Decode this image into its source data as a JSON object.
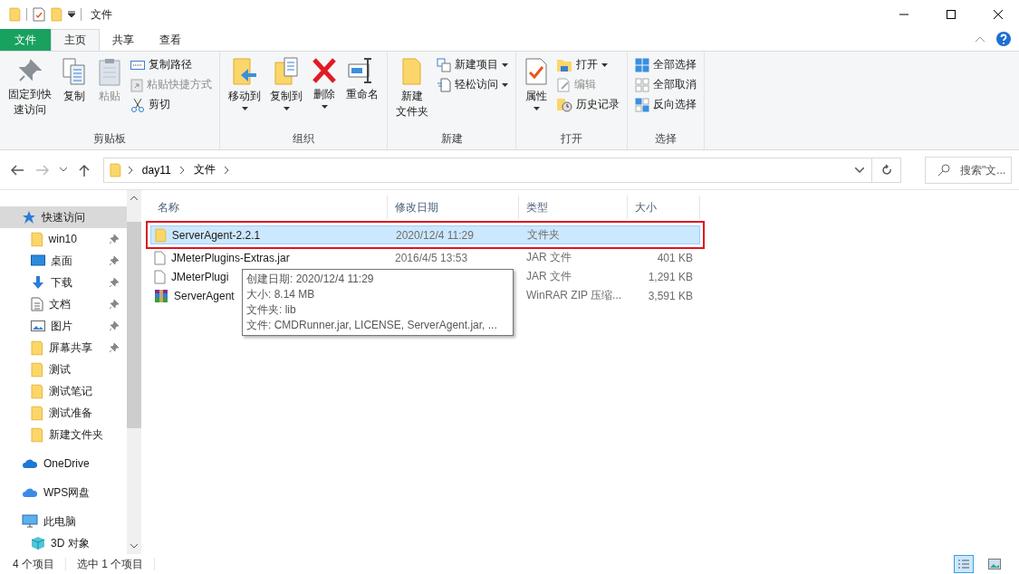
{
  "title_bar": {
    "title": "文件"
  },
  "ribbon_tabs": [
    {
      "label": "文件",
      "selected": false,
      "kind": "backstage"
    },
    {
      "label": "主页",
      "selected": true,
      "kind": "tab"
    },
    {
      "label": "共享",
      "selected": false,
      "kind": "tab"
    },
    {
      "label": "查看",
      "selected": false,
      "kind": "tab"
    }
  ],
  "ribbon_groups": [
    {
      "title": "剪贴板",
      "buttons": [
        {
          "kind": "large",
          "lines": [
            "固定到快",
            "速访问"
          ],
          "disabled": false,
          "dropdown": false
        },
        {
          "kind": "large",
          "lines": [
            "复制"
          ],
          "disabled": false,
          "dropdown": false
        },
        {
          "kind": "large",
          "lines": [
            "粘贴"
          ],
          "disabled": true,
          "dropdown": false
        },
        {
          "kind": "small",
          "lines": [
            "复制路径"
          ],
          "disabled": false,
          "dropdown": false
        },
        {
          "kind": "small",
          "lines": [
            "粘贴快捷方式"
          ],
          "disabled": true,
          "dropdown": false
        },
        {
          "kind": "small",
          "lines": [
            "剪切"
          ],
          "disabled": false,
          "dropdown": false
        }
      ]
    },
    {
      "title": "组织",
      "buttons": [
        {
          "kind": "large",
          "lines": [
            "移动到"
          ],
          "disabled": false,
          "dropdown": true
        },
        {
          "kind": "large",
          "lines": [
            "复制到"
          ],
          "disabled": false,
          "dropdown": true
        },
        {
          "kind": "large",
          "lines": [
            "删除"
          ],
          "disabled": false,
          "dropdown": true
        },
        {
          "kind": "large",
          "lines": [
            "重命名"
          ],
          "disabled": false,
          "dropdown": false
        }
      ]
    },
    {
      "title": "新建",
      "buttons": [
        {
          "kind": "large",
          "lines": [
            "新建",
            "文件夹"
          ],
          "disabled": false,
          "dropdown": false
        },
        {
          "kind": "small",
          "lines": [
            "新建项目"
          ],
          "disabled": false,
          "dropdown": true
        },
        {
          "kind": "small",
          "lines": [
            "轻松访问"
          ],
          "disabled": false,
          "dropdown": true
        }
      ]
    },
    {
      "title": "打开",
      "buttons": [
        {
          "kind": "large",
          "lines": [
            "属性"
          ],
          "disabled": false,
          "dropdown": true
        },
        {
          "kind": "small",
          "lines": [
            "打开"
          ],
          "disabled": false,
          "dropdown": true
        },
        {
          "kind": "small",
          "lines": [
            "编辑"
          ],
          "disabled": true,
          "dropdown": false
        },
        {
          "kind": "small",
          "lines": [
            "历史记录"
          ],
          "disabled": false,
          "dropdown": false
        }
      ]
    },
    {
      "title": "选择",
      "buttons": [
        {
          "kind": "small",
          "lines": [
            "全部选择"
          ],
          "disabled": false,
          "dropdown": false
        },
        {
          "kind": "small",
          "lines": [
            "全部取消"
          ],
          "disabled": false,
          "dropdown": false
        },
        {
          "kind": "small",
          "lines": [
            "反向选择"
          ],
          "disabled": false,
          "dropdown": false
        }
      ]
    }
  ],
  "address_bar": {
    "path": [
      "day11",
      "文件"
    ]
  },
  "search": {
    "placeholder": "搜索\"文..."
  },
  "sidebar": {
    "items": [
      {
        "label": "快速访问",
        "kind": "star",
        "selected": true,
        "children": [
          {
            "label": "win10",
            "kind": "folder",
            "selected": false,
            "pinned": true
          },
          {
            "label": "桌面",
            "kind": "desktop",
            "selected": false,
            "pinned": true
          },
          {
            "label": "下载",
            "kind": "download",
            "selected": false,
            "pinned": true
          },
          {
            "label": "文档",
            "kind": "document",
            "selected": false,
            "pinned": true
          },
          {
            "label": "图片",
            "kind": "picture",
            "selected": false,
            "pinned": true
          },
          {
            "label": "屏幕共享",
            "kind": "folder",
            "selected": false,
            "pinned": true
          },
          {
            "label": "测试",
            "kind": "folder",
            "selected": false,
            "pinned": false
          },
          {
            "label": "测试笔记",
            "kind": "folder",
            "selected": false,
            "pinned": false
          },
          {
            "label": "测试准备",
            "kind": "folder",
            "selected": false,
            "pinned": false
          },
          {
            "label": "新建文件夹",
            "kind": "folder",
            "selected": false,
            "pinned": false
          }
        ]
      },
      {
        "label": "OneDrive",
        "kind": "cloud",
        "selected": false
      },
      {
        "label": "WPS网盘",
        "kind": "cloud2",
        "selected": false
      },
      {
        "label": "此电脑",
        "kind": "pc",
        "selected": false,
        "children": [
          {
            "label": "3D 对象",
            "kind": "cube",
            "selected": false
          }
        ]
      }
    ]
  },
  "file_list": {
    "columns": [
      "名称",
      "修改日期",
      "类型",
      "大小"
    ],
    "rows": [
      {
        "name": "ServerAgent-2.2.1",
        "modified": "2020/12/4 11:29",
        "type": "文件夹",
        "kind": "folder",
        "selected": true,
        "annotated": true
      },
      {
        "name": "JMeterPlugins-Extras.jar",
        "modified": "2016/4/5 13:53",
        "type": "JAR 文件",
        "size": "401 KB",
        "kind": "file",
        "selected": false,
        "annotated": false
      },
      {
        "name": "JMeterPlugi",
        "type": "JAR 文件",
        "size": "1,291 KB",
        "kind": "file",
        "selected": false,
        "annotated": false
      },
      {
        "name": "ServerAgent",
        "type": "WinRAR ZIP 压缩...",
        "size": "3,591 KB",
        "kind": "archive",
        "selected": false,
        "annotated": false
      }
    ]
  },
  "tooltip": {
    "lines": [
      "创建日期: 2020/12/4 11:29",
      "大小: 8.14 MB",
      "文件夹: lib",
      "文件: CMDRunner.jar, LICENSE, ServerAgent.jar, ..."
    ]
  },
  "status_bar": {
    "item_count": "4 个项目",
    "selection": "选中 1 个项目",
    "views": [
      {
        "kind": "details",
        "selected": true
      },
      {
        "kind": "large-icons",
        "selected": false
      }
    ]
  }
}
